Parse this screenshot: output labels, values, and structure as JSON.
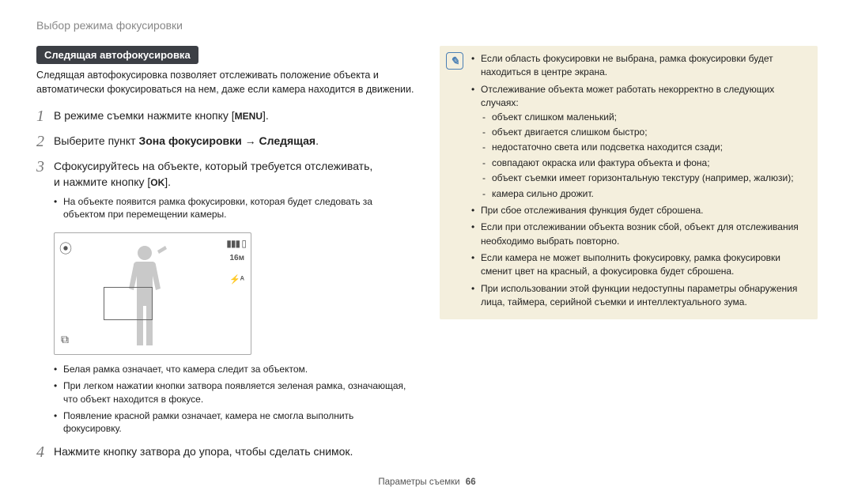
{
  "header": {
    "title": "Выбор режима фокусировки"
  },
  "pill": "Следящая автофокусировка",
  "intro": "Следящая автофокусировка позволяет отслеживать положение объекта и автоматически фокусироваться на нем, даже если камера находится в движении.",
  "steps": {
    "s1": {
      "num": "1",
      "pre": "В режиме съемки нажмите кнопку [",
      "icon": "MENU",
      "post": "]."
    },
    "s2": {
      "num": "2",
      "pre": "Выберите пункт ",
      "bold1": "Зона фокусировки",
      "arrow": " → ",
      "bold2": "Следящая",
      "post": "."
    },
    "s3": {
      "num": "3",
      "line1": "Сфокусируйтесь на объекте, который требуется отслеживать,",
      "line2a": "и нажмите кнопку [",
      "icon": "OK",
      "line2b": "].",
      "bullet": "На объекте появится рамка фокусировки, которая будет следовать за объектом при перемещении камеры."
    },
    "s4": {
      "num": "4",
      "text": "Нажмите кнопку затвора до упора, чтобы сделать снимок."
    }
  },
  "after_preview_bullets": [
    "Белая рамка означает, что камера следит за объектом.",
    "При легком нажатии кнопки затвора появляется зеленая рамка, означающая, что объект находится в фокусе.",
    "Появление красной рамки означает, камера не смогла выполнить фокусировку."
  ],
  "camera_icons": {
    "mode": "⦿",
    "battery": "▮▮▮ ▯",
    "res": "16ᴍ",
    "flash": "⚡ᴬ",
    "overlap": "⧉"
  },
  "note": {
    "n1": "Если область фокусировки не выбрана, рамка фокусировки будет находиться в центре экрана.",
    "n2": "Отслеживание объекта может работать некорректно в следующих случаях:",
    "n2_sub": [
      "объект слишком маленький;",
      "объект двигается слишком быстро;",
      "недостаточно света или подсветка находится сзади;",
      "совпадают окраска или фактура объекта и фона;",
      "объект съемки имеет горизонтальную текстуру (например, жалюзи);",
      "камера сильно дрожит."
    ],
    "n3": "При сбое отслеживания функция будет сброшена.",
    "n4": "Если при отслеживании объекта возник сбой, объект для отслеживания необходимо выбрать повторно.",
    "n5": "Если камера не может выполнить фокусировку, рамка фокусировки сменит цвет на красный, а фокусировка будет сброшена.",
    "n6": "При использовании этой функции недоступны параметры обнаружения лица, таймера, серийной съемки и интеллектуального зума."
  },
  "footer": {
    "section": "Параметры съемки",
    "page": "66"
  }
}
